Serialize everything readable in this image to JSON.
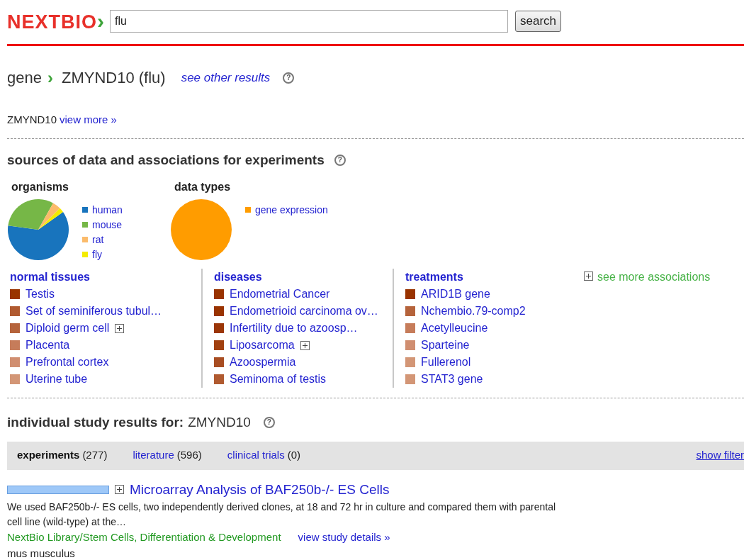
{
  "header": {
    "logo": "NEXTBIO",
    "logo_mark": "›",
    "search": {
      "value": "flu"
    },
    "search_button": "search"
  },
  "title": {
    "category": "gene",
    "arrow": "›",
    "name": "ZMYND10 (flu)",
    "other_link": "see other results",
    "help": "?"
  },
  "summary": {
    "gene": "ZMYND10",
    "link": "view more »"
  },
  "sources": {
    "heading": "sources of data and associations for experiments",
    "help": "?",
    "organisms": {
      "title": "organisms",
      "legend": [
        {
          "label": "human",
          "color": "#1874bd"
        },
        {
          "label": "mouse",
          "color": "#76b747"
        },
        {
          "label": "rat",
          "color": "#fbbb6b"
        },
        {
          "label": "fly",
          "color": "#f4ec00"
        }
      ]
    },
    "data_types": {
      "title": "data types",
      "legend": [
        {
          "label": "gene expression",
          "color": "#ff9c00"
        }
      ]
    },
    "columns": [
      {
        "title": "normal tissues",
        "items": [
          {
            "label": "Testis",
            "color": "#993300",
            "expandable": false
          },
          {
            "label": "Set of seminiferous tubul…",
            "color": "#b05a30",
            "expandable": false
          },
          {
            "label": "Diploid germ cell",
            "color": "#b5633b",
            "expandable": true
          },
          {
            "label": "Placenta",
            "color": "#c67c5a",
            "expandable": false
          },
          {
            "label": "Prefrontal cortex",
            "color": "#d08e70",
            "expandable": false
          },
          {
            "label": "Uterine tube",
            "color": "#d39676",
            "expandable": false
          }
        ]
      },
      {
        "title": "diseases",
        "items": [
          {
            "label": "Endometrial Cancer",
            "color": "#993300",
            "expandable": false
          },
          {
            "label": "Endometrioid carcinoma ov…",
            "color": "#993300",
            "expandable": false
          },
          {
            "label": "Infertility due to azoosp…",
            "color": "#9b3608",
            "expandable": false
          },
          {
            "label": "Liposarcoma",
            "color": "#a1400f",
            "expandable": true
          },
          {
            "label": "Azoospermia",
            "color": "#a84d22",
            "expandable": false
          },
          {
            "label": "Seminoma of testis",
            "color": "#b05a30",
            "expandable": false
          }
        ]
      },
      {
        "title": "treatments",
        "items": [
          {
            "label": "ARID1B gene",
            "color": "#993300",
            "expandable": false
          },
          {
            "label": "Nchembio.79-comp2",
            "color": "#b5633b",
            "expandable": false
          },
          {
            "label": "Acetylleucine",
            "color": "#c67c5a",
            "expandable": false
          },
          {
            "label": "Sparteine",
            "color": "#d08e70",
            "expandable": false
          },
          {
            "label": "Fullerenol",
            "color": "#d39676",
            "expandable": false
          },
          {
            "label": "STAT3 gene",
            "color": "#d39676",
            "expandable": false
          }
        ]
      }
    ],
    "more_link": "see more associations"
  },
  "results": {
    "heading": "individual study results for:",
    "gene": "ZMYND10",
    "help": "?",
    "tabs": [
      {
        "label": "experiments",
        "count": "(277)",
        "selected": true
      },
      {
        "label": "literature",
        "count": "(596)",
        "selected": false
      },
      {
        "label": "clinical trials",
        "count": "(0)",
        "selected": false
      }
    ],
    "filter_link": "show filter",
    "items": [
      {
        "title": "Microarray Analysis of BAF250b-/- ES Cells",
        "description": "We used BAF250b-/- ES cells, two independently derived clones, at 18 and 72 hr in culture and compared them with parental cell line (wild-type) at the…",
        "source": "NextBio Library/Stem Cells, Differentiation & Development",
        "details_link": "view study details »",
        "organism": "mus musculus"
      }
    ]
  }
}
